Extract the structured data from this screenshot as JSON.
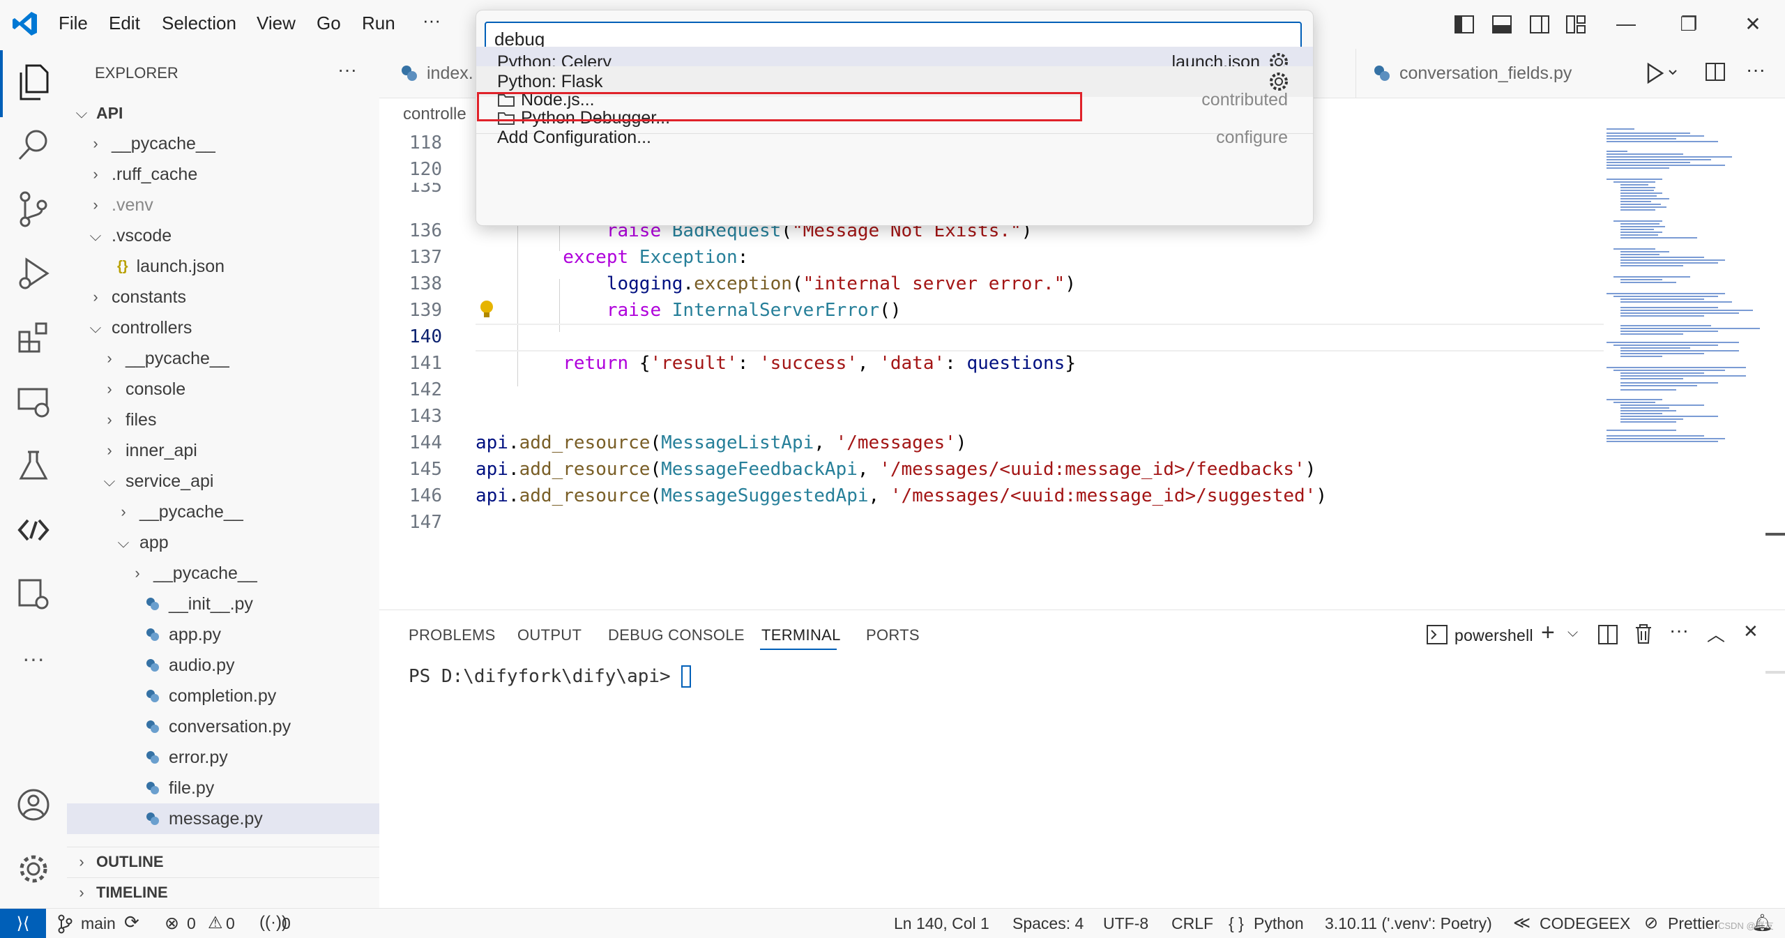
{
  "menu": [
    "File",
    "Edit",
    "Selection",
    "View",
    "Go",
    "Run"
  ],
  "menu_more": "···",
  "quickpick": {
    "input_value": "debug ",
    "items": [
      {
        "label": "Python: Celery",
        "description": "launch.json",
        "gear": true,
        "folder": false
      },
      {
        "label": "Python: Flask",
        "description": "",
        "gear": true,
        "folder": false
      },
      {
        "label": "Node.js...",
        "description": "contributed",
        "gear": false,
        "folder": true
      },
      {
        "label": "Python Debugger...",
        "description": "",
        "gear": false,
        "folder": true
      },
      {
        "label": "Add Configuration...",
        "description": "configure",
        "gear": false,
        "folder": false
      }
    ]
  },
  "sidebar": {
    "title": "EXPLORER",
    "root": "API",
    "tree": [
      {
        "label": "__pycache__",
        "indent": 1,
        "chev": ">",
        "type": "folder"
      },
      {
        "label": ".ruff_cache",
        "indent": 1,
        "chev": ">",
        "type": "folder"
      },
      {
        "label": ".venv",
        "indent": 1,
        "chev": ">",
        "type": "folder",
        "dim": true
      },
      {
        "label": ".vscode",
        "indent": 1,
        "chev": "v",
        "type": "folder"
      },
      {
        "label": "launch.json",
        "indent": 2,
        "chev": "",
        "type": "json"
      },
      {
        "label": "constants",
        "indent": 1,
        "chev": ">",
        "type": "folder"
      },
      {
        "label": "controllers",
        "indent": 1,
        "chev": "v",
        "type": "folder"
      },
      {
        "label": "__pycache__",
        "indent": 2,
        "chev": ">",
        "type": "folder"
      },
      {
        "label": "console",
        "indent": 2,
        "chev": ">",
        "type": "folder"
      },
      {
        "label": "files",
        "indent": 2,
        "chev": ">",
        "type": "folder"
      },
      {
        "label": "inner_api",
        "indent": 2,
        "chev": ">",
        "type": "folder"
      },
      {
        "label": "service_api",
        "indent": 2,
        "chev": "v",
        "type": "folder"
      },
      {
        "label": "__pycache__",
        "indent": 3,
        "chev": ">",
        "type": "folder"
      },
      {
        "label": "app",
        "indent": 3,
        "chev": "v",
        "type": "folder"
      },
      {
        "label": "__pycache__",
        "indent": 4,
        "chev": ">",
        "type": "folder"
      },
      {
        "label": "__init__.py",
        "indent": 4,
        "chev": "",
        "type": "py"
      },
      {
        "label": "app.py",
        "indent": 4,
        "chev": "",
        "type": "py"
      },
      {
        "label": "audio.py",
        "indent": 4,
        "chev": "",
        "type": "py"
      },
      {
        "label": "completion.py",
        "indent": 4,
        "chev": "",
        "type": "py"
      },
      {
        "label": "conversation.py",
        "indent": 4,
        "chev": "",
        "type": "py"
      },
      {
        "label": "error.py",
        "indent": 4,
        "chev": "",
        "type": "py"
      },
      {
        "label": "file.py",
        "indent": 4,
        "chev": "",
        "type": "py"
      },
      {
        "label": "message.py",
        "indent": 4,
        "chev": "",
        "type": "py",
        "selected": true
      }
    ],
    "outline": "OUTLINE",
    "timeline": "TIMELINE"
  },
  "tabs": {
    "left": "index.",
    "right": "conversation_fields.py",
    "breadcrumb": "controlle"
  },
  "code": [
    {
      "n": "118",
      "tokens": []
    },
    {
      "n": "120",
      "tokens": []
    },
    {
      "n": "135",
      "tokens": []
    },
    {
      "n": "136",
      "tokens": [
        [
          "kw",
          "            raise "
        ],
        [
          "cls",
          "BadRequest"
        ],
        [
          "plain",
          "("
        ],
        [
          "str",
          "\"Message Not Exists.\""
        ],
        [
          "plain",
          ")"
        ]
      ]
    },
    {
      "n": "137",
      "tokens": [
        [
          "kw",
          "        except "
        ],
        [
          "cls",
          "Exception"
        ],
        [
          "plain",
          ":"
        ]
      ]
    },
    {
      "n": "138",
      "tokens": [
        [
          "var",
          "            logging"
        ],
        [
          "plain",
          "."
        ],
        [
          "fn",
          "exception"
        ],
        [
          "plain",
          "("
        ],
        [
          "str",
          "\"internal server error.\""
        ],
        [
          "plain",
          ")"
        ]
      ]
    },
    {
      "n": "139",
      "tokens": [
        [
          "kw",
          "            raise "
        ],
        [
          "cls",
          "InternalServerError"
        ],
        [
          "plain",
          "()"
        ]
      ]
    },
    {
      "n": "140",
      "tokens": [],
      "active": true
    },
    {
      "n": "141",
      "tokens": [
        [
          "kw",
          "        return "
        ],
        [
          "plain",
          "{"
        ],
        [
          "str",
          "'result'"
        ],
        [
          "plain",
          ": "
        ],
        [
          "str",
          "'success'"
        ],
        [
          "plain",
          ", "
        ],
        [
          "str",
          "'data'"
        ],
        [
          "plain",
          ": "
        ],
        [
          "var",
          "questions"
        ],
        [
          "plain",
          "}"
        ]
      ]
    },
    {
      "n": "142",
      "tokens": []
    },
    {
      "n": "143",
      "tokens": []
    },
    {
      "n": "144",
      "tokens": [
        [
          "var",
          "api"
        ],
        [
          "plain",
          "."
        ],
        [
          "fn",
          "add_resource"
        ],
        [
          "plain",
          "("
        ],
        [
          "cls",
          "MessageListApi"
        ],
        [
          "plain",
          ", "
        ],
        [
          "str",
          "'/messages'"
        ],
        [
          "plain",
          ")"
        ]
      ]
    },
    {
      "n": "145",
      "tokens": [
        [
          "var",
          "api"
        ],
        [
          "plain",
          "."
        ],
        [
          "fn",
          "add_resource"
        ],
        [
          "plain",
          "("
        ],
        [
          "cls",
          "MessageFeedbackApi"
        ],
        [
          "plain",
          ", "
        ],
        [
          "str",
          "'/messages/<uuid:message_id>/feedbacks'"
        ],
        [
          "plain",
          ")"
        ]
      ]
    },
    {
      "n": "146",
      "tokens": [
        [
          "var",
          "api"
        ],
        [
          "plain",
          "."
        ],
        [
          "fn",
          "add_resource"
        ],
        [
          "plain",
          "("
        ],
        [
          "cls",
          "MessageSuggestedApi"
        ],
        [
          "plain",
          ", "
        ],
        [
          "str",
          "'/messages/<uuid:message_id>/suggested'"
        ],
        [
          "plain",
          ")"
        ]
      ]
    },
    {
      "n": "147",
      "tokens": []
    }
  ],
  "panel": {
    "tabs": [
      "PROBLEMS",
      "OUTPUT",
      "DEBUG CONSOLE",
      "TERMINAL",
      "PORTS"
    ],
    "active_tab": "TERMINAL",
    "shell": "powershell",
    "prompt": "PS D:\\difyfork\\dify\\api> "
  },
  "status": {
    "branch": "main",
    "errors": "0",
    "warnings": "0",
    "ports": "0",
    "position": "Ln 140, Col 1",
    "spaces": "Spaces: 4",
    "encoding": "UTF-8",
    "eol": "CRLF",
    "language": "Python",
    "interpreter": "3.10.11 ('.venv': Poetry)",
    "codegeex": "CODEGEEX",
    "prettier": "Prettier",
    "watermark": "CSDN @群友"
  },
  "colors": {
    "accent": "#005fb8",
    "highlight": "#e0222a",
    "remote": "#005fb8"
  }
}
